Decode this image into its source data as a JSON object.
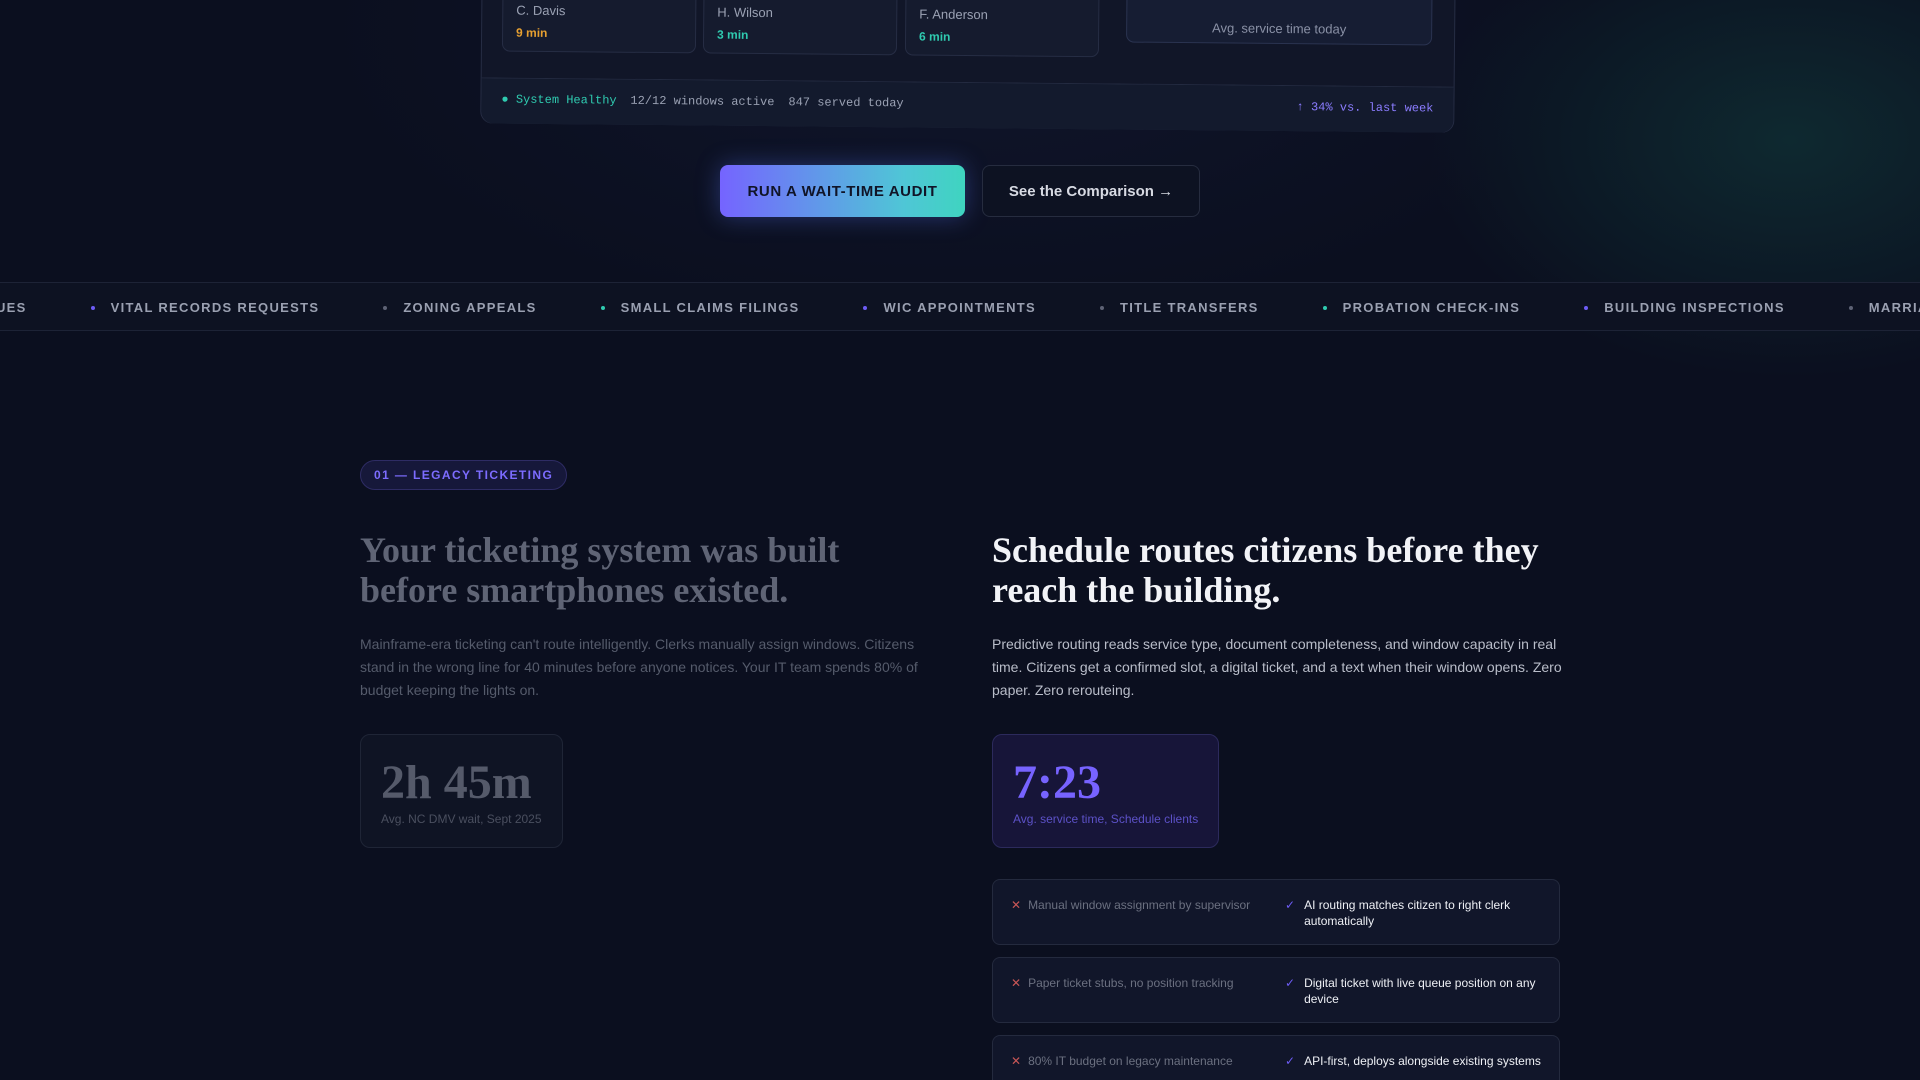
{
  "dashboard": {
    "clerks": [
      {
        "name": "C. Davis",
        "time": "9 min",
        "color": "#e7a030"
      },
      {
        "name": "H. Wilson",
        "time": "3 min",
        "color": "#2fcbb0"
      },
      {
        "name": "F. Anderson",
        "time": "6 min",
        "color": "#2fcbb0"
      }
    ],
    "avg_label": "Avg. service time today",
    "status": "● System Healthy",
    "windows": "12/12 windows active",
    "served": "847 served today",
    "trend": "↑ 34% vs. last week"
  },
  "cta": {
    "primary": "RUN A WAIT-TIME AUDIT",
    "secondary": "See the Comparison →"
  },
  "ticker": {
    "items": [
      {
        "label": "EUES",
        "dot": ""
      },
      {
        "label": "VITAL RECORDS REQUESTS",
        "dot": "#6d5cf5"
      },
      {
        "label": "ZONING APPEALS",
        "dot": "#5d6275"
      },
      {
        "label": "SMALL CLAIMS FILINGS",
        "dot": "#2fcbb0"
      },
      {
        "label": "WIC APPOINTMENTS",
        "dot": "#6d5cf5"
      },
      {
        "label": "TITLE TRANSFERS",
        "dot": "#5d6275"
      },
      {
        "label": "PROBATION CHECK-INS",
        "dot": "#2fcbb0"
      },
      {
        "label": "BUILDING INSPECTIONS",
        "dot": "#6d5cf5"
      },
      {
        "label": "MARRIAGE LICENSES",
        "dot": "#5d6275"
      }
    ]
  },
  "section": {
    "pill": "01 — LEGACY TICKETING",
    "left": {
      "heading": "Your ticketing system was built before smartphones existed.",
      "body": "Mainframe-era ticketing can't route intelligently. Clerks manually assign windows. Citizens stand in the wrong line for 40 minutes before anyone notices. Your IT team spends 80% of budget keeping the lights on.",
      "stat": "2h 45m",
      "stat_caption": "Avg. NC DMV wait, Sept 2025"
    },
    "right": {
      "heading": "Schedule routes citizens before they reach the building.",
      "body": "Predictive routing reads service type, document completeness, and window capacity in real time. Citizens get a confirmed slot, a digital ticket, and a text when their window opens. Zero paper. Zero rerouteing.",
      "stat": "7:23",
      "stat_caption": "Avg. service time, Schedule clients"
    },
    "comparisons": [
      {
        "bad": "Manual window assignment by supervisor",
        "good": "AI routing matches citizen to right clerk automatically"
      },
      {
        "bad": "Paper ticket stubs, no position tracking",
        "good": "Digital ticket with live queue position on any device"
      },
      {
        "bad": "80% IT budget on legacy maintenance",
        "good": "API-first, deploys alongside existing systems"
      }
    ]
  }
}
